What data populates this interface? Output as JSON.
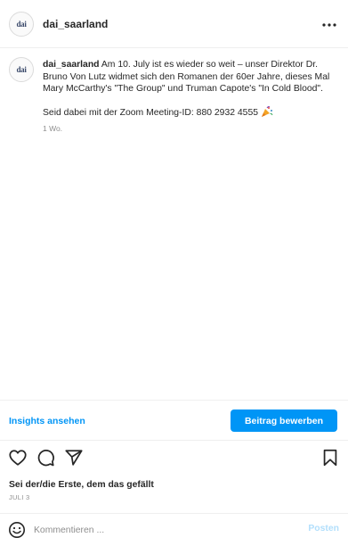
{
  "header": {
    "avatar_text": "dai",
    "username": "dai_saarland"
  },
  "caption": {
    "avatar_text": "dai",
    "username": "dai_saarland",
    "text": "Am 10. July ist es wieder so weit – unser Direktor Dr. Bruno Von Lutz widmet sich den Romanen der 60er Jahre, dieses Mal Mary McCarthy's \"The Group\" und Truman Capote's \"In Cold Blood\".",
    "zoom_text": "Seid dabei mit der Zoom Meeting-ID: 880 2932 4555",
    "time": "1 Wo."
  },
  "insights": {
    "link_label": "Insights ansehen",
    "promote_label": "Beitrag bewerben"
  },
  "likes": {
    "text": "Sei der/die Erste, dem das gefällt"
  },
  "date": {
    "text": "JULI 3"
  },
  "comment": {
    "placeholder": "Kommentieren ...",
    "post_label": "Posten"
  },
  "colors": {
    "accent": "#0095f6",
    "text": "#262626",
    "muted": "#8e8e8e",
    "post_disabled": "#b2dffc"
  },
  "icons": {
    "more": "more-horizontal-icon",
    "like": "heart-icon",
    "comment": "comment-bubble-icon",
    "share": "paper-plane-icon",
    "save": "bookmark-icon",
    "emoji": "smiley-icon",
    "caption_emoji": "party-popper-icon"
  }
}
